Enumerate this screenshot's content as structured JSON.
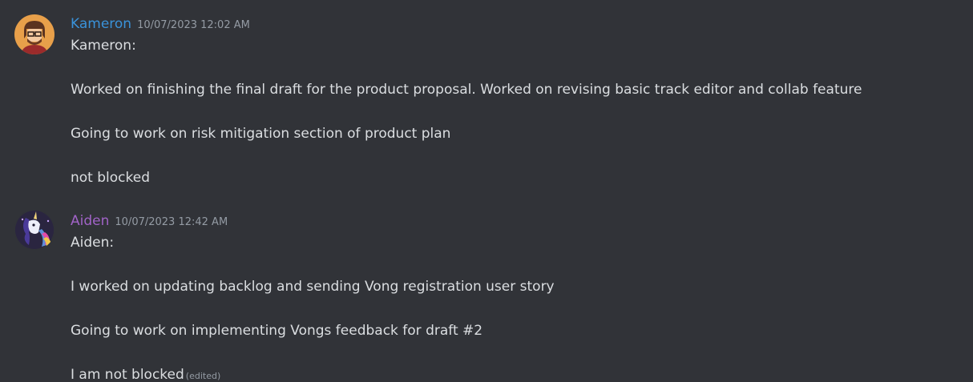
{
  "messages": [
    {
      "author": "Kameron",
      "author_color": "#3a92d9",
      "avatar_icon": "avatar-kameron-icon",
      "timestamp": "10/07/2023 12:02 AM",
      "lines": [
        "Kameron:",
        "Worked on finishing the final draft for the product proposal. Worked on revising basic track editor and collab feature",
        "Going to work on risk mitigation section of product plan",
        "not blocked"
      ]
    },
    {
      "author": "Aiden",
      "author_color": "#a163c7",
      "avatar_icon": "avatar-aiden-icon",
      "timestamp": "10/07/2023 12:42 AM",
      "lines": [
        "Aiden:",
        "I worked on updating backlog and sending Vong registration user story",
        "Going to work on implementing Vongs feedback for draft #2",
        "I am not blocked"
      ],
      "edited_label": "(edited)"
    }
  ],
  "colors": {
    "background": "#313338",
    "message_text": "#dbdee1",
    "timestamp": "#949ba4"
  }
}
